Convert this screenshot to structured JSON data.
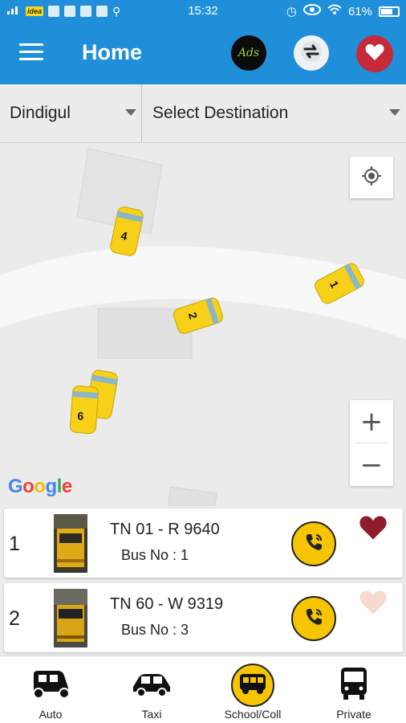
{
  "status_bar": {
    "carrier_badge": "idea",
    "time": "15:32",
    "battery": "61%"
  },
  "app_bar": {
    "title": "Home",
    "ads_label": "Ads",
    "ads_icon": "ads-icon",
    "swap_icon": "swap-arrows-icon",
    "favorites_icon": "heart-icon"
  },
  "selectors": {
    "origin": "Dindigul",
    "destination": "Select Destination"
  },
  "map": {
    "google_logo": "Google",
    "zoom_in": "+",
    "zoom_out": "−",
    "buses": [
      {
        "label": "4"
      },
      {
        "label": "1"
      },
      {
        "label": "2"
      },
      {
        "label": ""
      },
      {
        "label": "6"
      }
    ]
  },
  "bus_list": [
    {
      "index": "1",
      "registration": "TN 01 - R 9640",
      "bus_no": "Bus No : 1",
      "favorite": true
    },
    {
      "index": "2",
      "registration": "TN 60 - W 9319",
      "bus_no": "Bus No : 3",
      "favorite": false
    }
  ],
  "bottom_nav": [
    {
      "label": "Auto",
      "icon": "auto-rickshaw-icon",
      "active": false
    },
    {
      "label": "Taxi",
      "icon": "taxi-icon",
      "active": false
    },
    {
      "label": "School/Coll",
      "icon": "school-bus-icon",
      "active": true
    },
    {
      "label": "Private",
      "icon": "private-bus-icon",
      "active": false
    }
  ],
  "colors": {
    "primary": "#1f8fd9",
    "accent": "#f6c400",
    "favorite_active": "#8e1c2c",
    "favorite_inactive": "#f6d9cf"
  }
}
